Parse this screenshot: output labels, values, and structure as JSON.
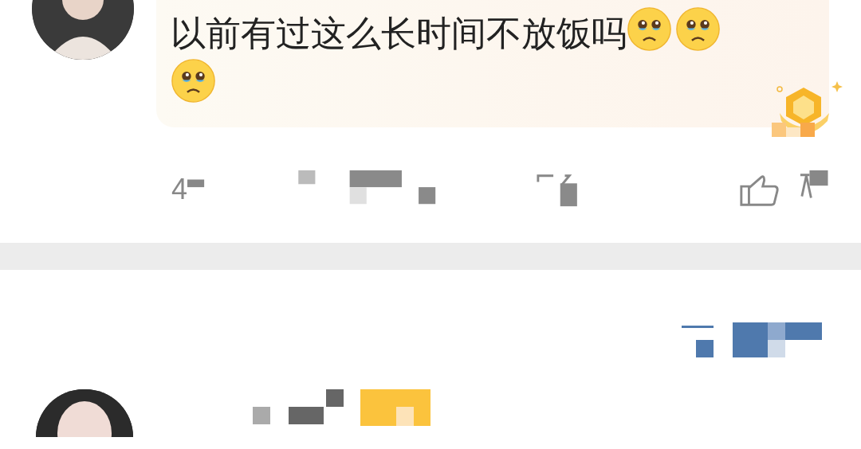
{
  "comment": {
    "text": "以前有过这么长时间不放饭吗",
    "emoji": [
      {
        "kind": "pleading"
      },
      {
        "kind": "pleading"
      },
      {
        "kind": "pleading"
      }
    ],
    "time": "4"
  }
}
